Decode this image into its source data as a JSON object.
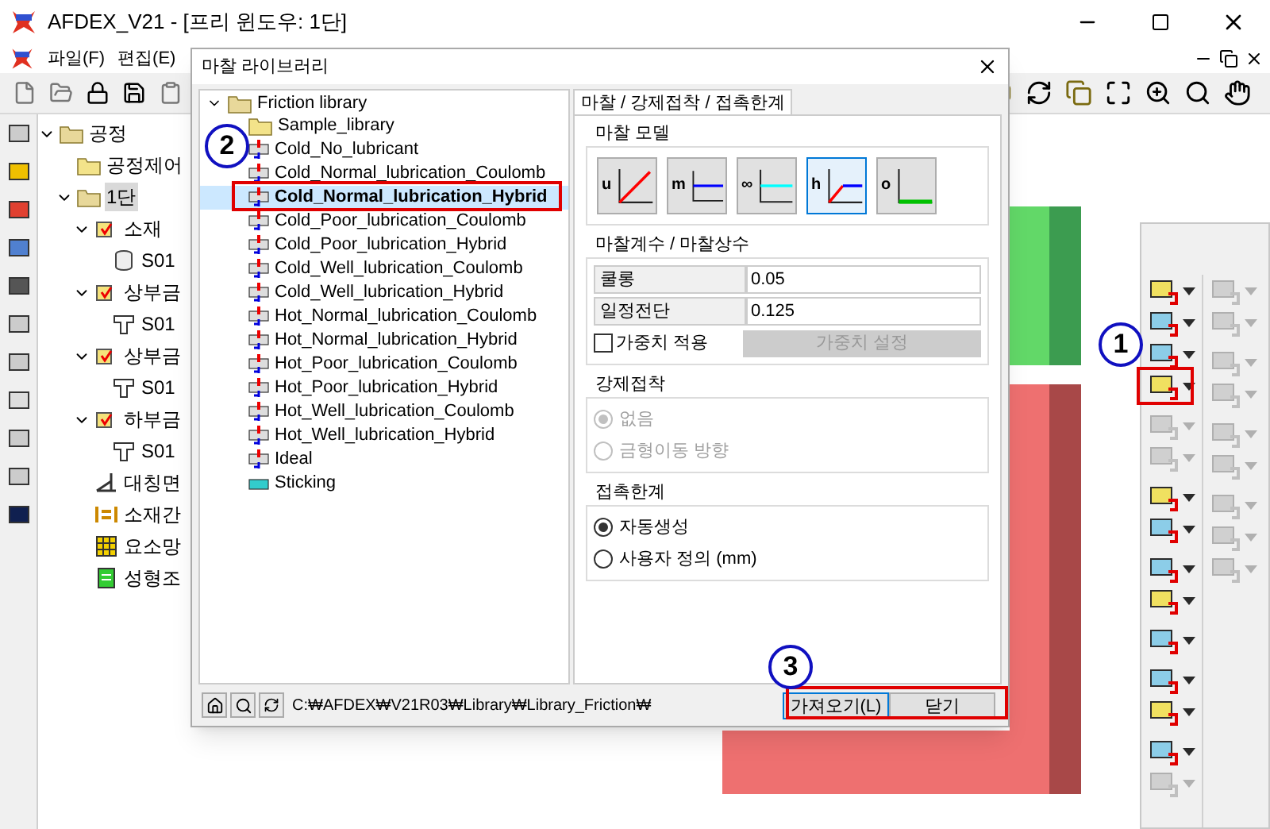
{
  "window": {
    "title": "AFDEX_V21 - [프리 윈도우: 1단]"
  },
  "menu": [
    "파일(F)",
    "편집(E)"
  ],
  "process_tree": [
    {
      "label": "공정",
      "kind": "folder",
      "expanded": true,
      "selected": false,
      "children": [
        {
          "label": "공정제어",
          "kind": "folder",
          "selected": false
        },
        {
          "label": "1단",
          "kind": "folder",
          "expanded": true,
          "selected": true,
          "children": [
            {
              "label": "소재",
              "kind": "part",
              "expanded": true,
              "selected": false,
              "children": [
                {
                  "label": "S01",
                  "kind": "cylinder",
                  "selected": false
                }
              ]
            },
            {
              "label": "상부금",
              "kind": "part",
              "expanded": true,
              "selected": false,
              "children": [
                {
                  "label": "S01",
                  "kind": "die",
                  "selected": false
                }
              ]
            },
            {
              "label": "상부금",
              "kind": "part",
              "expanded": true,
              "selected": false,
              "children": [
                {
                  "label": "S01",
                  "kind": "die",
                  "selected": false
                }
              ]
            },
            {
              "label": "하부금",
              "kind": "part",
              "expanded": true,
              "selected": false,
              "children": [
                {
                  "label": "S01",
                  "kind": "die",
                  "selected": false
                }
              ]
            },
            {
              "label": "대칭면",
              "kind": "plane",
              "selected": false
            },
            {
              "label": "소재간",
              "kind": "contact",
              "selected": false
            },
            {
              "label": "요소망",
              "kind": "mesh",
              "selected": false
            },
            {
              "label": "성형조",
              "kind": "condition",
              "selected": false
            }
          ]
        }
      ]
    }
  ],
  "dialog": {
    "title": "마찰 라이브러리",
    "library_tree": {
      "label": "Friction library",
      "kind": "folder",
      "expanded": true,
      "children": [
        {
          "label": "Sample_library",
          "kind": "folder",
          "selected": false
        },
        {
          "label": "Cold_No_lubricant",
          "kind": "friction",
          "selected": false
        },
        {
          "label": "Cold_Normal_lubrication_Coulomb",
          "kind": "friction",
          "selected": false
        },
        {
          "label": "Cold_Normal_lubrication_Hybrid",
          "kind": "friction",
          "selected": true
        },
        {
          "label": "Cold_Poor_lubrication_Coulomb",
          "kind": "friction",
          "selected": false
        },
        {
          "label": "Cold_Poor_lubrication_Hybrid",
          "kind": "friction",
          "selected": false
        },
        {
          "label": "Cold_Well_lubrication_Coulomb",
          "kind": "friction",
          "selected": false
        },
        {
          "label": "Cold_Well_lubrication_Hybrid",
          "kind": "friction",
          "selected": false
        },
        {
          "label": "Hot_Normal_lubrication_Coulomb",
          "kind": "friction",
          "selected": false
        },
        {
          "label": "Hot_Normal_lubrication_Hybrid",
          "kind": "friction",
          "selected": false
        },
        {
          "label": "Hot_Poor_lubrication_Coulomb",
          "kind": "friction",
          "selected": false
        },
        {
          "label": "Hot_Poor_lubrication_Hybrid",
          "kind": "friction",
          "selected": false
        },
        {
          "label": "Hot_Well_lubrication_Coulomb",
          "kind": "friction",
          "selected": false
        },
        {
          "label": "Hot_Well_lubrication_Hybrid",
          "kind": "friction",
          "selected": false
        },
        {
          "label": "Ideal",
          "kind": "friction",
          "selected": false
        },
        {
          "label": "Sticking",
          "kind": "sticking",
          "selected": false
        }
      ]
    },
    "tab": "마찰 / 강제접착 / 접촉한계",
    "model_group": "마찰 모델",
    "models": [
      {
        "letter": "u",
        "kind": "linear",
        "color": "#ff0000",
        "selected": false
      },
      {
        "letter": "m",
        "kind": "flat",
        "color": "#0000ff",
        "selected": false
      },
      {
        "letter": "∞",
        "kind": "flat",
        "color": "#00ffff",
        "selected": false
      },
      {
        "letter": "h",
        "kind": "hybrid",
        "color": "#0000ff",
        "selected": true
      },
      {
        "letter": "o",
        "kind": "zero",
        "color": "#00c000",
        "selected": false
      }
    ],
    "coef_group": "마찰계수 / 마찰상수",
    "coefficients": [
      {
        "label": "쿨롱",
        "value": "0.05"
      },
      {
        "label": "일정전단",
        "value": "0.125"
      }
    ],
    "weight_checkbox": {
      "label": "가중치 적용",
      "checked": false
    },
    "weight_button": {
      "label": "가중치 설정",
      "disabled": true
    },
    "forced_group": "강제접착",
    "forced_options": [
      {
        "label": "없음",
        "selected": true,
        "disabled": true
      },
      {
        "label": "금형이동 방향",
        "selected": false,
        "disabled": true
      }
    ],
    "limit_group": "접촉한계",
    "limit_options": [
      {
        "label": "자동생성",
        "selected": true,
        "disabled": false
      },
      {
        "label": "사용자 정의 (mm)",
        "selected": false,
        "disabled": false
      }
    ],
    "path": "C:₩AFDEX₩V21R03₩Library₩Library_Friction₩",
    "buttons": [
      {
        "label": "가져오기(L)",
        "focused": true
      },
      {
        "label": "닫기",
        "focused": false
      }
    ]
  },
  "tool_palette": {
    "left": [
      {
        "disabled": false
      },
      {
        "disabled": false
      },
      {
        "disabled": false
      },
      {
        "disabled": false
      },
      {
        "disabled": true
      },
      {
        "disabled": true
      },
      {
        "disabled": false
      },
      {
        "disabled": false
      },
      {
        "disabled": false
      },
      {
        "disabled": false
      },
      {
        "disabled": false
      },
      {
        "disabled": false
      },
      {
        "disabled": false
      },
      {
        "disabled": false
      },
      {
        "disabled": true
      }
    ],
    "right": [
      {
        "disabled": true
      },
      {
        "disabled": true
      },
      {
        "disabled": true
      },
      {
        "disabled": true
      },
      {
        "disabled": true
      },
      {
        "disabled": true
      },
      {
        "disabled": true
      },
      {
        "disabled": true
      },
      {
        "disabled": true
      }
    ]
  },
  "callouts": [
    "1",
    "2",
    "3"
  ]
}
